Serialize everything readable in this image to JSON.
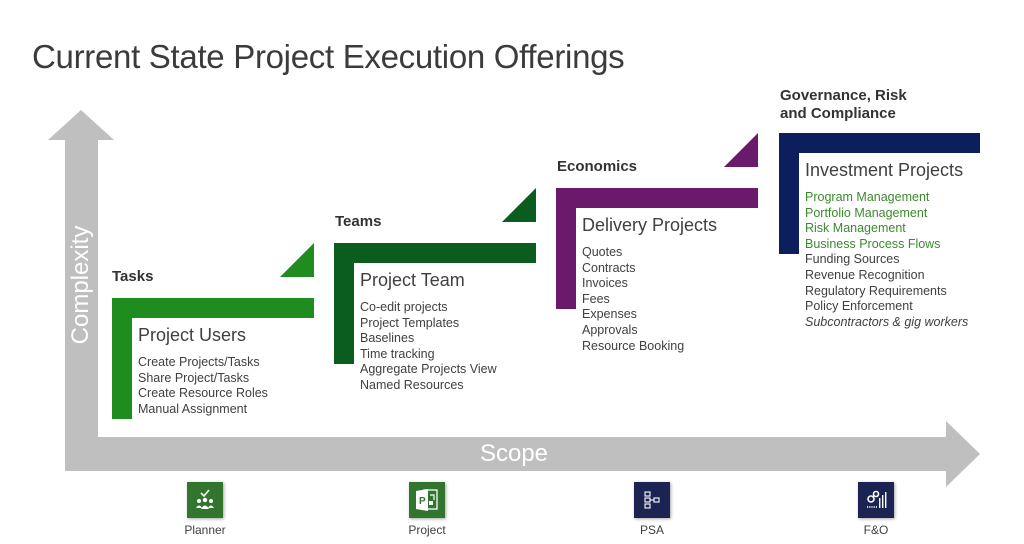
{
  "title": "Current State Project Execution Offerings",
  "axes": {
    "y_label": "Complexity",
    "x_label": "Scope",
    "color": "#bfbfbf"
  },
  "stages": [
    {
      "heading": "Tasks",
      "color": "#1e8c1e",
      "card_title": "Project Users",
      "items": [
        {
          "text": "Create Projects/Tasks"
        },
        {
          "text": "Share Project/Tasks"
        },
        {
          "text": "Create Resource Roles"
        },
        {
          "text": "Manual Assignment"
        }
      ]
    },
    {
      "heading": "Teams",
      "color": "#0b5c1f",
      "card_title": "Project Team",
      "items": [
        {
          "text": "Co-edit projects"
        },
        {
          "text": "Project Templates"
        },
        {
          "text": "Baselines"
        },
        {
          "text": "Time tracking"
        },
        {
          "text": "Aggregate Projects View"
        },
        {
          "text": "Named Resources"
        }
      ]
    },
    {
      "heading": "Economics",
      "color": "#6b1a6b",
      "card_title": "Delivery Projects",
      "items": [
        {
          "text": "Quotes"
        },
        {
          "text": "Contracts"
        },
        {
          "text": "Invoices"
        },
        {
          "text": "Fees"
        },
        {
          "text": "Expenses"
        },
        {
          "text": "Approvals"
        },
        {
          "text": "Resource Booking"
        }
      ]
    },
    {
      "heading_line1": "Governance, Risk",
      "heading_line2": "and Compliance",
      "color": "#0c1f5c",
      "card_title": "Investment Projects",
      "items": [
        {
          "text": "Program Management",
          "style": "highlight"
        },
        {
          "text": "Portfolio Management",
          "style": "highlight"
        },
        {
          "text": "Risk Management",
          "style": "highlight"
        },
        {
          "text": "Business Process Flows",
          "style": "highlight"
        },
        {
          "text": "Funding Sources"
        },
        {
          "text": "Revenue Recognition"
        },
        {
          "text": "Regulatory Requirements"
        },
        {
          "text": "Policy Enforcement"
        },
        {
          "text": "Subcontractors & gig workers",
          "style": "italic"
        }
      ]
    }
  ],
  "highlight_color": "#3c8a2e",
  "apps": [
    {
      "label": "Planner",
      "icon": "planner-icon",
      "color": "#31752f"
    },
    {
      "label": "Project",
      "icon": "project-icon",
      "color": "#31752f"
    },
    {
      "label": "PSA",
      "icon": "psa-icon",
      "color": "#1b2352"
    },
    {
      "label": "F&O",
      "icon": "finance-operations-icon",
      "color": "#1b2352"
    }
  ]
}
